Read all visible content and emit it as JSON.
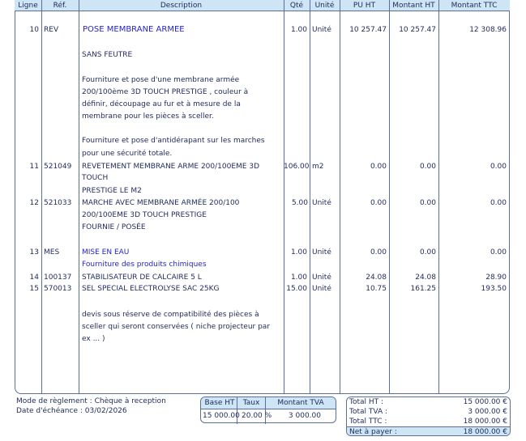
{
  "headers": {
    "ligne": "Ligne",
    "ref": "Réf.",
    "description": "Description",
    "qte": "Qté",
    "unite": "Unité",
    "pu_ht": "PU HT",
    "montant_ht": "Montant HT",
    "montant_ttc": "Montant TTC"
  },
  "rows": [
    {
      "ligne": "10",
      "ref": "REV",
      "description": "POSE MEMBRANE ARMEE",
      "qte": "1.00",
      "unite": "Unité",
      "pu_ht": "10 257.47",
      "montant_ht": "10 257.47",
      "montant_ttc": "12 308.96"
    },
    {
      "description": "SANS FEUTRE"
    },
    {
      "description": "Fourniture et pose d'une membrane armée"
    },
    {
      "description": "200/100ème 3D TOUCH PRESTIGE , couleur à"
    },
    {
      "description": "définir, découpage au fur et à mesure de la"
    },
    {
      "description": "membrane pour les pièces à sceller."
    },
    {
      "description": "Fourniture et pose d'antidérapant sur les marches"
    },
    {
      "description": "pour une sécurité totale."
    },
    {
      "ligne": "11",
      "ref": "521049",
      "description": "REVETEMENT MEMBRANE ARME 200/100EME 3D",
      "qte": "106.00",
      "unite": "m2",
      "pu_ht": "0.00",
      "montant_ht": "0.00",
      "montant_ttc": "0.00"
    },
    {
      "description": "TOUCH"
    },
    {
      "description": "PRESTIGE LE M2"
    },
    {
      "ligne": "12",
      "ref": "521033",
      "description": "MARCHE AVEC MEMBRANE ARMÉE 200/100",
      "qte": "5.00",
      "unite": "Unité",
      "pu_ht": "0.00",
      "montant_ht": "0.00",
      "montant_ttc": "0.00"
    },
    {
      "description": "200/100EME 3D TOUCH PRESTIGE"
    },
    {
      "description": "FOURNIE / POSÉE"
    },
    {
      "ligne": "13",
      "ref": "MES",
      "description": "MISE EN EAU",
      "qte": "1.00",
      "unite": "Unité",
      "pu_ht": "0.00",
      "montant_ht": "0.00",
      "montant_ttc": "0.00"
    },
    {
      "description": "Fourniture des produits chimiques"
    },
    {
      "ligne": "14",
      "ref": "100137",
      "description": "STABILISATEUR DE CALCAIRE 5 L",
      "qte": "1.00",
      "unite": "Unité",
      "pu_ht": "24.08",
      "montant_ht": "24.08",
      "montant_ttc": "28.90"
    },
    {
      "ligne": "15",
      "ref": "570013",
      "description": "SEL SPECIAL ELECTROLYSE SAC 25KG",
      "qte": "15.00",
      "unite": "Unité",
      "pu_ht": "10.75",
      "montant_ht": "161.25",
      "montant_ttc": "193.50"
    },
    {
      "description": "devis sous réserve de compatibilité des pièces à"
    },
    {
      "description": "sceller qui seront conservées ( niche projecteur par"
    },
    {
      "description": "ex ... )"
    }
  ],
  "footer": {
    "mode_reglement": "Mode de règlement : Chèque à reception",
    "date_echeance": "Date d'échéance : 03/02/2026"
  },
  "tva_box": {
    "headers": {
      "base_ht": "Base HT",
      "taux": "Taux",
      "montant_tva": "Montant TVA"
    },
    "base_ht": "15 000.00",
    "taux": "20.00 %",
    "montant_tva": "3 000.00"
  },
  "totals": {
    "total_ht_label": "Total HT :",
    "total_ht": "15 000.00 €",
    "total_tva_label": "Total TVA :",
    "total_tva": "3 000.00 €",
    "total_ttc_label": "Total TTC :",
    "total_ttc": "18 000.00 €",
    "net_label": "Net à payer :",
    "net": "18 000.00 €"
  },
  "colors": {
    "header_bg": "#cde5f4",
    "border": "#5a6f9a",
    "title_blue": "#2424c8"
  }
}
